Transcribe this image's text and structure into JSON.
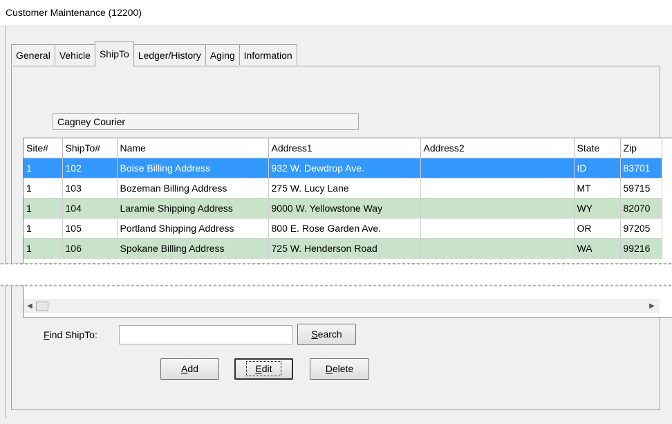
{
  "window": {
    "title": "Customer Maintenance (12200)"
  },
  "tabs": [
    {
      "label": "General"
    },
    {
      "label": "Vehicle"
    },
    {
      "label": "ShipTo"
    },
    {
      "label": "Ledger/History"
    },
    {
      "label": "Aging"
    },
    {
      "label": "Information"
    }
  ],
  "active_tab": "ShipTo",
  "customer": {
    "name": "Cagney Courier"
  },
  "grid": {
    "columns": [
      "Site#",
      "ShipTo#",
      "Name",
      "Address1",
      "Address2",
      "State",
      "Zip"
    ],
    "rows": [
      {
        "site": "1",
        "shipto": "102",
        "name": "Boise Billing Address",
        "address1": "932 W. Dewdrop Ave.",
        "address2": "",
        "state": "ID",
        "zip": "83701",
        "style": "selected"
      },
      {
        "site": "1",
        "shipto": "103",
        "name": "Bozeman Billing Address",
        "address1": "275 W. Lucy Lane",
        "address2": "",
        "state": "MT",
        "zip": "59715",
        "style": "white"
      },
      {
        "site": "1",
        "shipto": "104",
        "name": "Laramie Shipping Address",
        "address1": "9000 W. Yellowstone Way",
        "address2": "",
        "state": "WY",
        "zip": "82070",
        "style": "green"
      },
      {
        "site": "1",
        "shipto": "105",
        "name": "Portland Shipping Address",
        "address1": "800 E. Rose Garden Ave.",
        "address2": "",
        "state": "OR",
        "zip": "97205",
        "style": "white"
      },
      {
        "site": "1",
        "shipto": "106",
        "name": "Spokane Billing Address",
        "address1": "725 W. Henderson Road",
        "address2": "",
        "state": "WA",
        "zip": "99216",
        "style": "green"
      }
    ]
  },
  "find": {
    "label_mnemonic": "F",
    "label_rest": "ind ShipTo:",
    "value": ""
  },
  "buttons": {
    "search": {
      "mnemonic": "S",
      "rest": "earch"
    },
    "add": {
      "mnemonic": "A",
      "rest": "dd"
    },
    "edit": {
      "mnemonic": "E",
      "rest": "dit"
    },
    "delete": {
      "mnemonic": "D",
      "rest": "elete"
    }
  },
  "colors": {
    "selected_row": "#3399ff",
    "alt_row": "#c8e3c9"
  }
}
